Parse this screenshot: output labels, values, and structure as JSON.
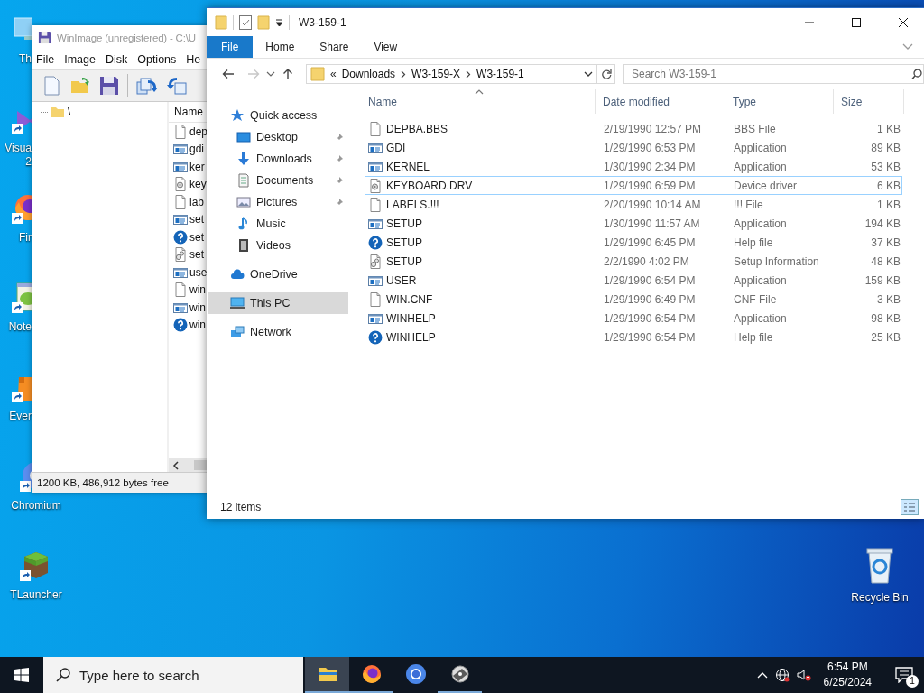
{
  "desktop": {
    "icons": [
      {
        "label": "Th",
        "kind": "pc",
        "shortcut": false
      },
      {
        "label": "Visua",
        "label_2": "2",
        "kind": "vs",
        "shortcut": true
      },
      {
        "label": "Fir",
        "kind": "firefox",
        "shortcut": true
      },
      {
        "label": "Note",
        "kind": "notepad",
        "shortcut": true
      },
      {
        "label": "Ever",
        "kind": "evernote",
        "shortcut": true
      },
      {
        "label": "Chromium",
        "kind": "chromium",
        "shortcut": true
      },
      {
        "label": "TLauncher",
        "kind": "tlauncher",
        "shortcut": true
      }
    ],
    "recycle_bin": {
      "label": "Recycle Bin"
    }
  },
  "winimage": {
    "title": "WinImage (unregistered) - C:\\U",
    "menu": [
      "File",
      "Image",
      "Disk",
      "Options",
      "He"
    ],
    "tree": [
      {
        "label": "\\"
      }
    ],
    "list_header": "Name",
    "files": [
      {
        "name": "dep",
        "kind": "doc"
      },
      {
        "name": "gdi",
        "kind": "app"
      },
      {
        "name": "ker",
        "kind": "app"
      },
      {
        "name": "key",
        "kind": "driver"
      },
      {
        "name": "lab",
        "kind": "doc"
      },
      {
        "name": "set",
        "kind": "app"
      },
      {
        "name": "set",
        "kind": "help"
      },
      {
        "name": "set",
        "kind": "inf"
      },
      {
        "name": "use",
        "kind": "app"
      },
      {
        "name": "win",
        "kind": "doc"
      },
      {
        "name": "win",
        "kind": "app"
      },
      {
        "name": "win",
        "kind": "help"
      }
    ],
    "status": "1200 KB, 486,912 bytes free"
  },
  "explorer": {
    "title": "W3-159-1",
    "ribbon_tabs": [
      {
        "label": "File",
        "selected": true
      },
      {
        "label": "Home",
        "selected": false
      },
      {
        "label": "Share",
        "selected": false
      },
      {
        "label": "View",
        "selected": false
      }
    ],
    "address_overflow": "«",
    "breadcrumbs": [
      "Downloads",
      "W3-159-X",
      "W3-159-1"
    ],
    "search": {
      "placeholder": "Search W3-159-1"
    },
    "nav": [
      {
        "label": "Quick access",
        "kind": "star",
        "selected": false,
        "children": [
          {
            "label": "Desktop",
            "kind": "desktop",
            "pinned": true,
            "selected": false
          },
          {
            "label": "Downloads",
            "kind": "downloads",
            "pinned": true,
            "selected": false
          },
          {
            "label": "Documents",
            "kind": "documents",
            "pinned": true,
            "selected": false
          },
          {
            "label": "Pictures",
            "kind": "pictures",
            "pinned": true,
            "selected": false
          },
          {
            "label": "Music",
            "kind": "music",
            "pinned": false,
            "selected": false
          },
          {
            "label": "Videos",
            "kind": "videos",
            "pinned": false,
            "selected": false
          }
        ]
      },
      {
        "label": "OneDrive",
        "kind": "cloud",
        "selected": false
      },
      {
        "label": "This PC",
        "kind": "pc",
        "selected": true
      },
      {
        "label": "Network",
        "kind": "network",
        "selected": false
      }
    ],
    "columns": [
      "Name",
      "Date modified",
      "Type",
      "Size"
    ],
    "files": [
      {
        "name": "DEPBA.BBS",
        "date": "2/19/1990 12:57 PM",
        "type": "BBS File",
        "size": "1 KB",
        "kind": "doc",
        "selected": false
      },
      {
        "name": "GDI",
        "date": "1/29/1990 6:53 PM",
        "type": "Application",
        "size": "89 KB",
        "kind": "app",
        "selected": false
      },
      {
        "name": "KERNEL",
        "date": "1/30/1990 2:34 PM",
        "type": "Application",
        "size": "53 KB",
        "kind": "app",
        "selected": false
      },
      {
        "name": "KEYBOARD.DRV",
        "date": "1/29/1990 6:59 PM",
        "type": "Device driver",
        "size": "6 KB",
        "kind": "driver",
        "selected": true
      },
      {
        "name": "LABELS.!!!",
        "date": "2/20/1990 10:14 AM",
        "type": "!!! File",
        "size": "1 KB",
        "kind": "doc",
        "selected": false
      },
      {
        "name": "SETUP",
        "date": "1/30/1990 11:57 AM",
        "type": "Application",
        "size": "194 KB",
        "kind": "app",
        "selected": false
      },
      {
        "name": "SETUP",
        "date": "1/29/1990 6:45 PM",
        "type": "Help file",
        "size": "37 KB",
        "kind": "help",
        "selected": false
      },
      {
        "name": "SETUP",
        "date": "2/2/1990 4:02 PM",
        "type": "Setup Information",
        "size": "48 KB",
        "kind": "inf",
        "selected": false
      },
      {
        "name": "USER",
        "date": "1/29/1990 6:54 PM",
        "type": "Application",
        "size": "159 KB",
        "kind": "app",
        "selected": false
      },
      {
        "name": "WIN.CNF",
        "date": "1/29/1990 6:49 PM",
        "type": "CNF File",
        "size": "3 KB",
        "kind": "doc",
        "selected": false
      },
      {
        "name": "WINHELP",
        "date": "1/29/1990 6:54 PM",
        "type": "Application",
        "size": "98 KB",
        "kind": "app",
        "selected": false
      },
      {
        "name": "WINHELP",
        "date": "1/29/1990 6:54 PM",
        "type": "Help file",
        "size": "25 KB",
        "kind": "help",
        "selected": false
      }
    ],
    "status": "12 items"
  },
  "taskbar": {
    "search": {
      "placeholder": "Type here to search"
    },
    "apps": [
      {
        "kind": "explorer",
        "active": true,
        "running": true
      },
      {
        "kind": "firefox",
        "active": false,
        "running": true
      },
      {
        "kind": "chromium",
        "active": false,
        "running": false
      },
      {
        "kind": "winimage",
        "active": false,
        "running": true
      }
    ],
    "time": "6:54 PM",
    "date": "6/25/2024",
    "notifications": "1"
  }
}
